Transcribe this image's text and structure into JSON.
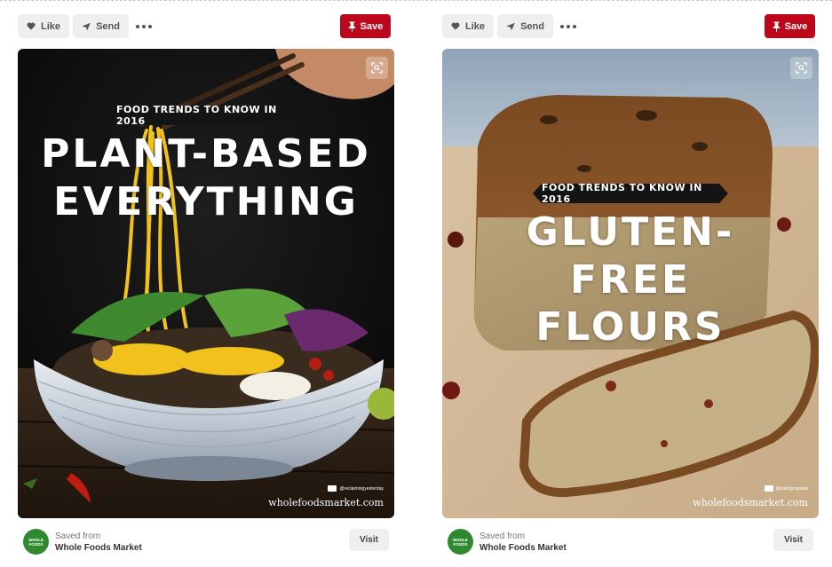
{
  "actions": {
    "like_label": "Like",
    "send_label": "Send",
    "save_label": "Save"
  },
  "pins": [
    {
      "banner": "FOOD TRENDS TO KNOW IN 2016",
      "headline": [
        "PLANT-BASED",
        "EVERYTHING"
      ],
      "photo_credit": "@reclaimingyesterday",
      "site": "wholefoodsmarket.com",
      "saved_from_label": "Saved from",
      "source_name": "Whole Foods Market",
      "logo_text": "WHOLE FOODS",
      "visit_label": "Visit"
    },
    {
      "banner": "FOOD TRENDS TO KNOW IN 2016",
      "headline": [
        "GLUTEN-FREE",
        "FLOURS"
      ],
      "photo_credit": "@eatingmyplate",
      "site": "wholefoodsmarket.com",
      "saved_from_label": "Saved from",
      "source_name": "Whole Foods Market",
      "logo_text": "WHOLE FOODS",
      "visit_label": "Visit"
    }
  ],
  "colors": {
    "save_red": "#bd081c",
    "button_gray": "#efefef",
    "logo_green": "#2f8a2f"
  }
}
